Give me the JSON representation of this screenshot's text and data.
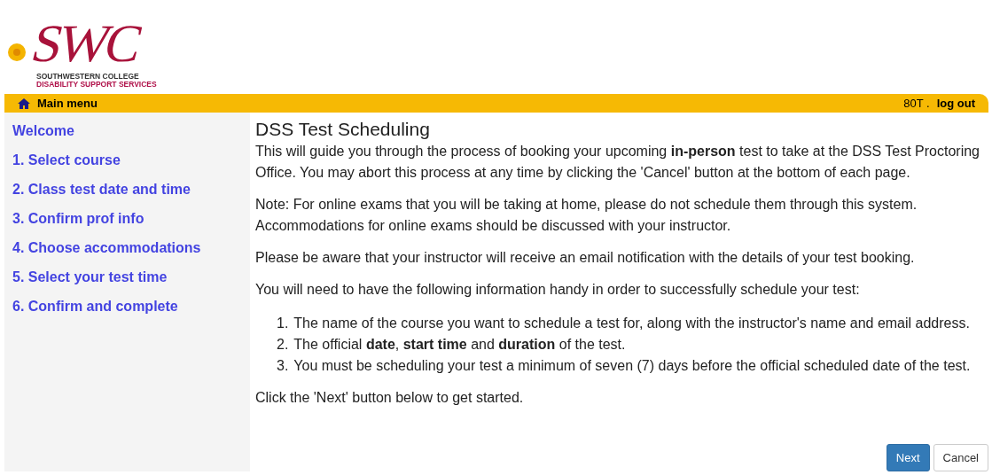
{
  "logo": {
    "mark": "SWC",
    "line_1": "SOUTHWESTERN COLLEGE",
    "line_2": "DISABILITY SUPPORT SERVICES"
  },
  "menu_bar": {
    "main_menu": "Main menu",
    "user": "80T .",
    "logout": "log out"
  },
  "sidebar": {
    "items": [
      {
        "label": "Welcome"
      },
      {
        "label": "1. Select course"
      },
      {
        "label": "2. Class test date and time"
      },
      {
        "label": "3. Confirm prof info"
      },
      {
        "label": "4. Choose accommodations"
      },
      {
        "label": "5. Select your test time"
      },
      {
        "label": "6. Confirm and complete"
      }
    ]
  },
  "content": {
    "title": "DSS Test Scheduling",
    "paragraphs": [
      "This will guide you through the process of booking your upcoming **in-person** test to take at the DSS Test Proctoring Office. You may abort this process at any time by clicking the 'Cancel' button at the bottom of each page.",
      "Note: For online exams that you will be taking at home, please do not schedule them through this system. Accommodations for online exams should be discussed with your instructor.",
      "Please be aware that your instructor will receive an email notification with the details of your test booking.",
      "You will need to have the following information handy in order to successfully schedule your test:"
    ],
    "list": [
      {
        "number": "1.",
        "text": "The name of the course you want to schedule a test for, along with the instructor's name and email address."
      },
      {
        "number": "2.",
        "text": "The official **date**, **start time** and **duration** of the test."
      },
      {
        "number": "3.",
        "text": "You must be scheduling your test a minimum of seven (7) days before the official scheduled date of the test."
      }
    ],
    "closing": "Click the 'Next' button below to get started.",
    "buttons": [
      {
        "label": "Next",
        "kind": "primary"
      },
      {
        "label": "Cancel",
        "kind": "default"
      }
    ]
  }
}
